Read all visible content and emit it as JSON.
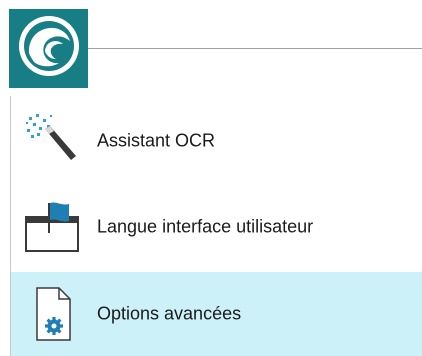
{
  "header": {
    "app_button_icon": "app-logo-icon"
  },
  "menu": {
    "items": [
      {
        "label": "Assistant OCR",
        "icon": "magic-wand-icon"
      },
      {
        "label": "Langue interface utilisateur",
        "icon": "flag-window-icon"
      },
      {
        "label": "Options avancées",
        "icon": "settings-document-icon"
      }
    ],
    "selected_index": 2
  },
  "colors": {
    "app_button": "#177e85",
    "selected_background": "#cdf1f8",
    "icon_accent": "#1f7fb5"
  }
}
